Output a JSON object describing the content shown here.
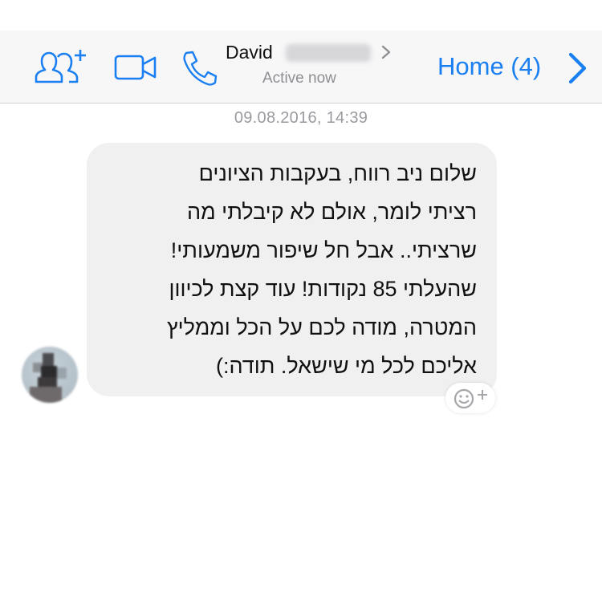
{
  "header": {
    "contact_name": "David",
    "status": "Active now",
    "home_label": "Home (4)"
  },
  "conversation": {
    "timestamp": "09.08.2016, 14:39",
    "message_lines": [
      "שלום ניב רווח,  בעקבות הציונים",
      "רציתי לומר,  אולם לא קיבלתי מה",
      "שרציתי..  אבל חל שיפור משמעותי!",
      "שהעלתי 85 נקודות!  עוד קצת לכיוון",
      "המטרה,  מודה לכם על הכל וממליץ",
      "אליכם לכל מי שישאל.  תודה:)"
    ]
  },
  "icons": {
    "add_people": "add-people-icon",
    "video_call": "video-camera-icon",
    "voice_call": "phone-icon",
    "contact_details": "chevron-right-icon",
    "home_back": "chevron-right-icon",
    "reaction": "smiley-plus-icon"
  },
  "colors": {
    "accent": "#1a7ff0",
    "bubble": "#f0f0f0",
    "header_bg": "#f7f7f8",
    "secondary_text": "#8e8e93"
  }
}
